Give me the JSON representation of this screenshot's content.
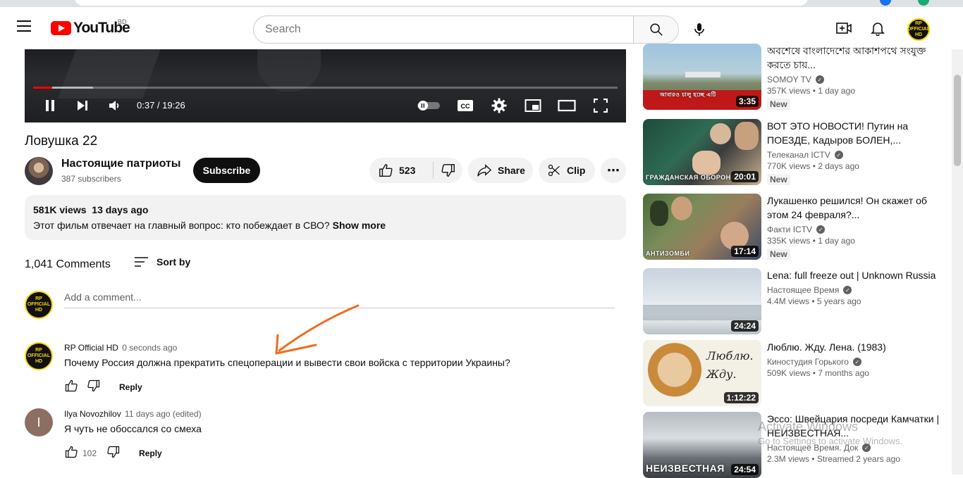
{
  "masthead": {
    "logo_text": "YouTube",
    "country_code": "BD",
    "search_placeholder": "Search",
    "account_badge": [
      "RP",
      "OFFICIAL",
      "HD"
    ]
  },
  "player": {
    "time": "0:37 / 19:26",
    "progress_fraction": 0.032
  },
  "video": {
    "title": "Ловушка 22",
    "channel": "Настоящие патриоты",
    "subscribers": "387 subscribers",
    "subscribe_label": "Subscribe",
    "likes": "523",
    "share_label": "Share",
    "clip_label": "Clip",
    "more_label": "⋯"
  },
  "description": {
    "views": "581K views",
    "age": "13 days ago",
    "text": "Этот фильм отвечает на главный вопрос: кто побеждает в СВО?",
    "show_more": "Show more"
  },
  "comments": {
    "count": "1,041 Comments",
    "sort_label": "Sort by",
    "add_placeholder": "Add a comment...",
    "items": [
      {
        "author": "RP Official HD",
        "when": "0 seconds ago",
        "text": "Почему Россия должна прекратить спецоперации и вывести свои войска с территории Украины?",
        "likes": "",
        "reply": "Reply"
      },
      {
        "author": "Ilya Novozhilov",
        "when": "11 days ago (edited)",
        "avatar_letter": "I",
        "text": "Я чуть не обоссался со смеха",
        "likes": "102",
        "reply": "Reply"
      }
    ]
  },
  "sidebar": [
    {
      "title": "অবশেষে বাংলাদেশের আকাশপথে সংযুক্ত করতে চায়...",
      "channel": "SOMOY TV",
      "meta": "357K views • 1 day ago",
      "badge": "New",
      "duration": "3:35",
      "thumb_caption": "আবারও চালু হচ্ছে এটি"
    },
    {
      "title": "ВОТ ЭТО НОВОСТИ! Путин на ПОЕЗДЕ, Кадыров БОЛЕН,...",
      "channel": "Телеканал ICTV",
      "meta": "770K views • 2 days ago",
      "badge": "New",
      "duration": "20:01",
      "thumb_caption": "ГРАЖДАНСКАЯ ОБОРОНА"
    },
    {
      "title": "Лукашенко решился! Он скажет об этом 24 февраля?...",
      "channel": "Факти ICTV",
      "meta": "335K views • 1 day ago",
      "badge": "New",
      "duration": "17:14",
      "thumb_caption": "АНТИЗОМБИ"
    },
    {
      "title": "Lena: full freeze out | Unknown Russia",
      "channel": "Настоящее Время",
      "meta": "4.4M views • 5 years ago",
      "badge": "",
      "duration": "24:24",
      "thumb_caption": ""
    },
    {
      "title": "Люблю. Жду. Лена. (1983)",
      "channel": "Киностудия Горького",
      "meta": "509K views • 7 months ago",
      "badge": "",
      "duration": "1:12:22",
      "thumb_caption": "Люблю. Жду."
    },
    {
      "title": "Эссо: Швейцария посреди Камчатки | НЕИЗВЕСТНАЯ...",
      "channel": "Настоящее Время. Док",
      "meta": "2.3M views • Streamed 2 years ago",
      "badge": "",
      "duration": "24:54",
      "thumb_caption": "НЕИЗВЕСТНАЯ"
    }
  ],
  "watermark": {
    "line1": "Activate Windows",
    "line2": "Go to Settings to activate Windows."
  },
  "colors": {
    "brand_red": "#ff0000",
    "annotation_arrow": "#f26b21"
  }
}
